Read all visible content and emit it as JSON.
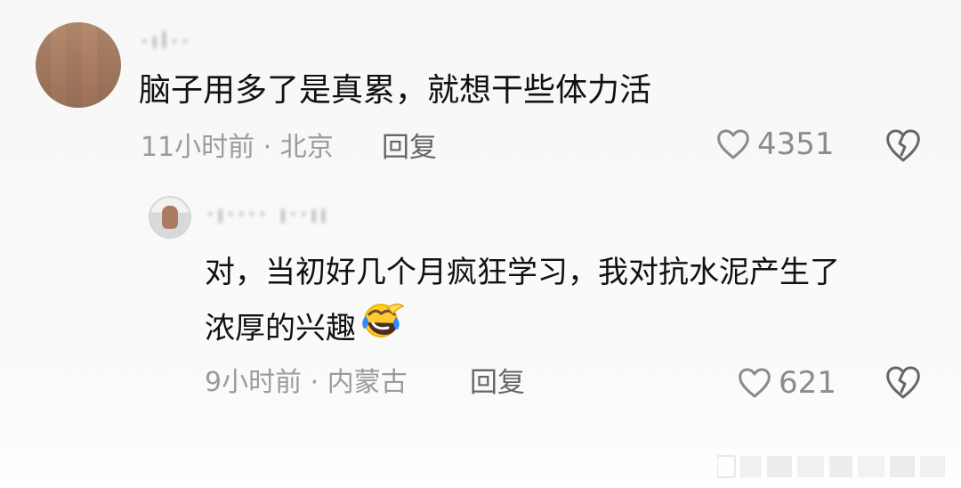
{
  "comment": {
    "text": "脑子用多了是真累，就想干些体力活",
    "time_location": "11小时前 · 北京",
    "reply_label": "回复",
    "likes": "4351",
    "like_icon": "heart-icon",
    "dislike_icon": "broken-heart-icon"
  },
  "reply": {
    "text_line1": "对，当初好几个月疯狂学习，我对抗水泥产生了",
    "text_line2": "浓厚的兴趣",
    "emoji_icon": "laughing-crying-emoji",
    "time_location": "9小时前 · 内蒙古",
    "reply_label": "回复",
    "likes": "621",
    "like_icon": "heart-icon",
    "dislike_icon": "broken-heart-icon"
  },
  "colors": {
    "primary_text": "#111111",
    "secondary_text": "#9b9b9b",
    "action_text": "#666666",
    "icon_gray": "#8b8b8b",
    "background": "#f7f7f7"
  }
}
